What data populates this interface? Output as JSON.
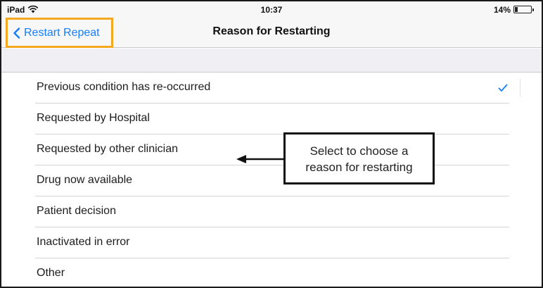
{
  "status_bar": {
    "device": "iPad",
    "time": "10:37",
    "battery": "14%",
    "icons": [
      "wifi-icon",
      "battery-icon"
    ]
  },
  "nav_bar": {
    "back_label": "Restart Repeat",
    "back_icon": "chevron-left-icon",
    "title": "Reason for Restarting"
  },
  "options": [
    {
      "label": "Previous condition has re-occurred",
      "selected": true
    },
    {
      "label": "Requested by Hospital",
      "selected": false
    },
    {
      "label": "Requested by other clinician",
      "selected": false
    },
    {
      "label": "Drug now available",
      "selected": false
    },
    {
      "label": "Patient decision",
      "selected": false
    },
    {
      "label": "Inactivated in error",
      "selected": false
    },
    {
      "label": "Other",
      "selected": false
    }
  ],
  "callout": {
    "line1": "Select to choose a",
    "line2": "reason for restarting"
  },
  "colors": {
    "accent": "#157efb",
    "highlight_border": "#f4a81d",
    "section_background": "#efeff4"
  }
}
